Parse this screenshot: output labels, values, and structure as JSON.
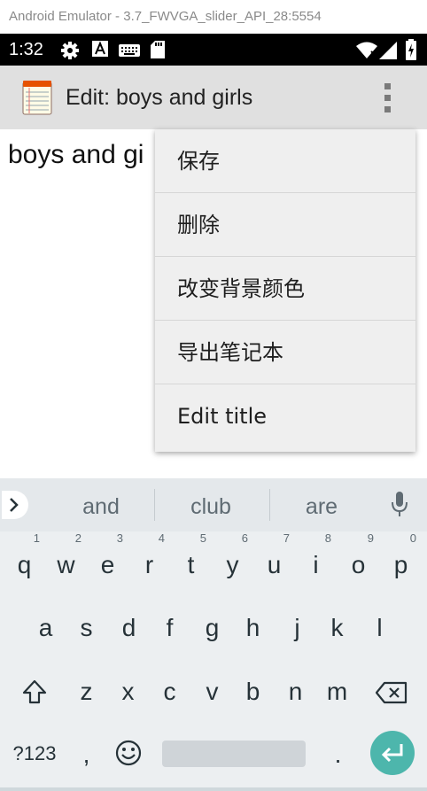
{
  "emulator": {
    "title": "Android Emulator - 3.7_FWVGA_slider_API_28:5554"
  },
  "status_bar": {
    "time": "1:32"
  },
  "app_bar": {
    "title": "Edit: boys and girls"
  },
  "editor": {
    "text": "boys and gi"
  },
  "menu": {
    "items": [
      {
        "label": "保存"
      },
      {
        "label": "删除"
      },
      {
        "label": "改变背景颜色"
      },
      {
        "label": "导出笔记本"
      },
      {
        "label": "Edit title"
      }
    ]
  },
  "keyboard": {
    "suggestions": [
      "and",
      "club",
      "are"
    ],
    "row1": [
      {
        "key": "q",
        "num": "1"
      },
      {
        "key": "w",
        "num": "2"
      },
      {
        "key": "e",
        "num": "3"
      },
      {
        "key": "r",
        "num": "4"
      },
      {
        "key": "t",
        "num": "5"
      },
      {
        "key": "y",
        "num": "6"
      },
      {
        "key": "u",
        "num": "7"
      },
      {
        "key": "i",
        "num": "8"
      },
      {
        "key": "o",
        "num": "9"
      },
      {
        "key": "p",
        "num": "0"
      }
    ],
    "row2": [
      "a",
      "s",
      "d",
      "f",
      "g",
      "h",
      "j",
      "k",
      "l"
    ],
    "row3": [
      "z",
      "x",
      "c",
      "v",
      "b",
      "n",
      "m"
    ],
    "symbols_label": "?123",
    "comma": ",",
    "period": "."
  },
  "colors": {
    "accent": "#4db6ac",
    "app_bar": "#e0e0e0",
    "status_bar": "#000000"
  }
}
